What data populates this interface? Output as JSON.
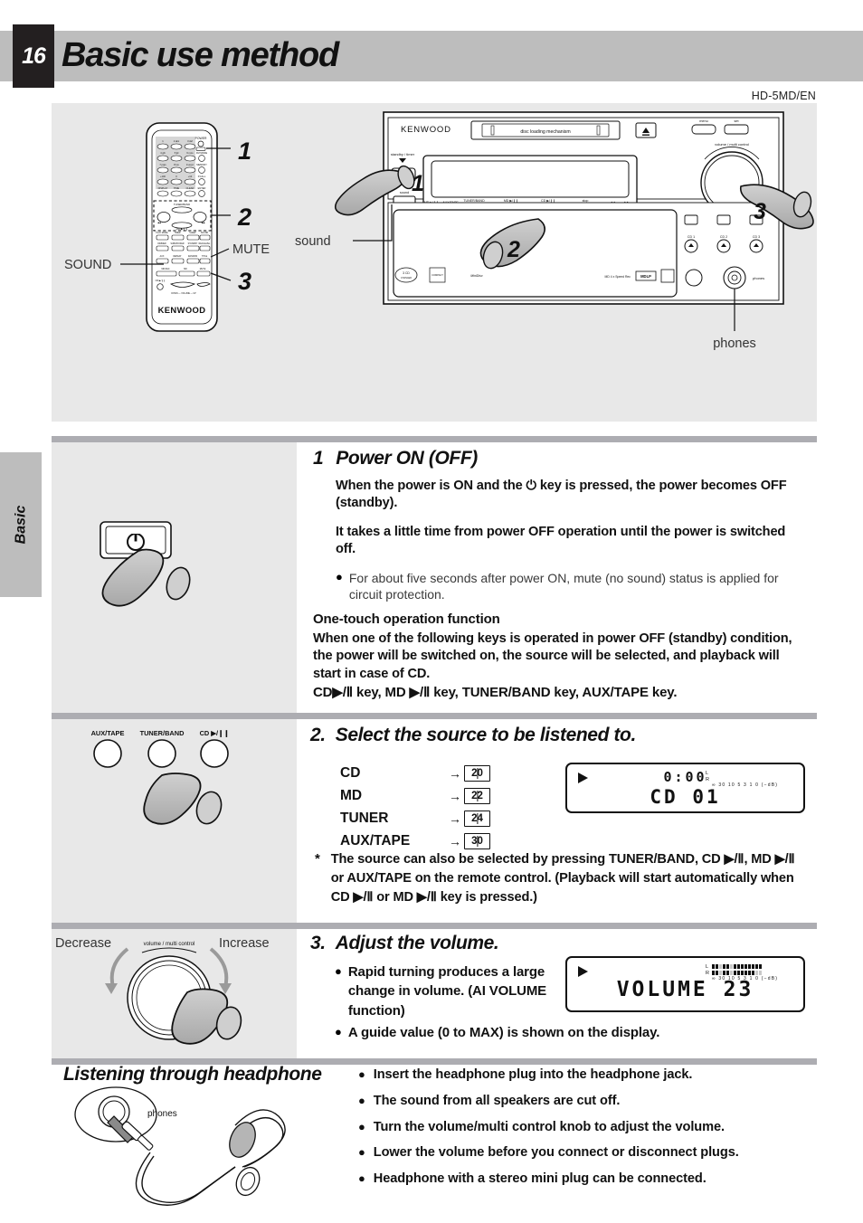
{
  "header": {
    "page_number": "16",
    "title": "Basic use method",
    "model_code": "HD-5MD/EN"
  },
  "side_tab": {
    "label": "Basic"
  },
  "illustration": {
    "remote": {
      "brand": "KENWOOD",
      "callouts": [
        "1",
        "2",
        "3"
      ],
      "label_sound": "SOUND",
      "label_mute": "MUTE"
    },
    "unit": {
      "brand": "KENWOOD",
      "disc_mechanism_label": "disc loading mechanism",
      "standby_timer_label": "standby / timer",
      "sound_button_label": "sound",
      "volume_knob_label": "volume / multi control",
      "menu_label": "menu",
      "set_label": "set",
      "md_speed_label": "MD 4 x Speed Rec",
      "callouts": [
        "1",
        "2",
        "3"
      ],
      "callout_sound": "sound",
      "callout_phones": "phones",
      "cd_tray_labels": [
        "CD 1",
        "CD 2",
        "CD 3"
      ]
    }
  },
  "section1": {
    "number": "1",
    "heading": "Power ON (OFF)",
    "paragraphs": [
      "When the power is ON and the ⏻ key is pressed, the power becomes OFF (standby).",
      "It takes a little time from power OFF operation until the power is switched off."
    ],
    "bullet": "For about five seconds after power ON, mute (no sound) status is applied for circuit protection.",
    "subheading": "One-touch operation function",
    "subtext": "When one of the following keys is operated in power OFF (standby) condition, the power will be switched on, the source will be selected, and playback will start in case of CD.",
    "keys_line": "CD▶/Ⅱ key, MD ▶/Ⅱ  key, TUNER/BAND key, AUX/TAPE key.",
    "illustration_power_symbol": "⏻"
  },
  "section2": {
    "number": "2.",
    "heading": "Select the source to be listened to.",
    "sources": [
      {
        "name": "CD",
        "page": "20"
      },
      {
        "name": "MD",
        "page": "22"
      },
      {
        "name": "TUNER",
        "page": "24"
      },
      {
        "name": "AUX/TAPE",
        "page": "30"
      }
    ],
    "note_marker": "*",
    "note": "The source can also be selected by pressing TUNER/BAND, CD ▶/Ⅱ, MD ▶/Ⅱ or AUX/TAPE on the remote control. (Playback will start automatically when CD ▶/Ⅱ or MD ▶/Ⅱ key is pressed.)",
    "buttons": [
      "AUX/TAPE",
      "TUNER/BAND",
      "CD ▶/Ⅱ"
    ],
    "display": {
      "play_indicator": "▶",
      "line1": "0:00",
      "line2": "CD 01",
      "meter_left_label": "L",
      "meter_right_label": "R",
      "meter_scale": "∞ 30 10 5  3  1  0 (−dB)"
    }
  },
  "section3": {
    "number": "3.",
    "heading": "Adjust the volume.",
    "bullets": [
      "Rapid turning produces a large change in volume. (AI VOLUME function)",
      "A guide value (0 to MAX) is shown on the display."
    ],
    "knob_label_decrease": "Decrease",
    "knob_label_increase": "Increase",
    "knob_label_center": "volume / multi control",
    "display": {
      "play_indicator": "▶",
      "line1": "VOLUME 23",
      "meter_left_label": "L",
      "meter_right_label": "R",
      "meter_scale": "∞ 30 10 5  3  1  0 (−dB)"
    }
  },
  "headphone_section": {
    "title": "Listening through headphone",
    "jack_label": "phones",
    "items": [
      "Insert the headphone plug into the headphone jack.",
      "The sound from all speakers are cut off.",
      "Turn the volume/multi control knob to adjust the volume.",
      "Lower the volume before you connect or disconnect plugs.",
      "Headphone with a stereo mini plug can be connected."
    ]
  },
  "colors": {
    "header_band": "#bdbdbd",
    "page_box": "#231f20",
    "panel_gray": "#e8e8e8",
    "divider": "#adadb2",
    "hand_gray": "#b3b3b3"
  }
}
